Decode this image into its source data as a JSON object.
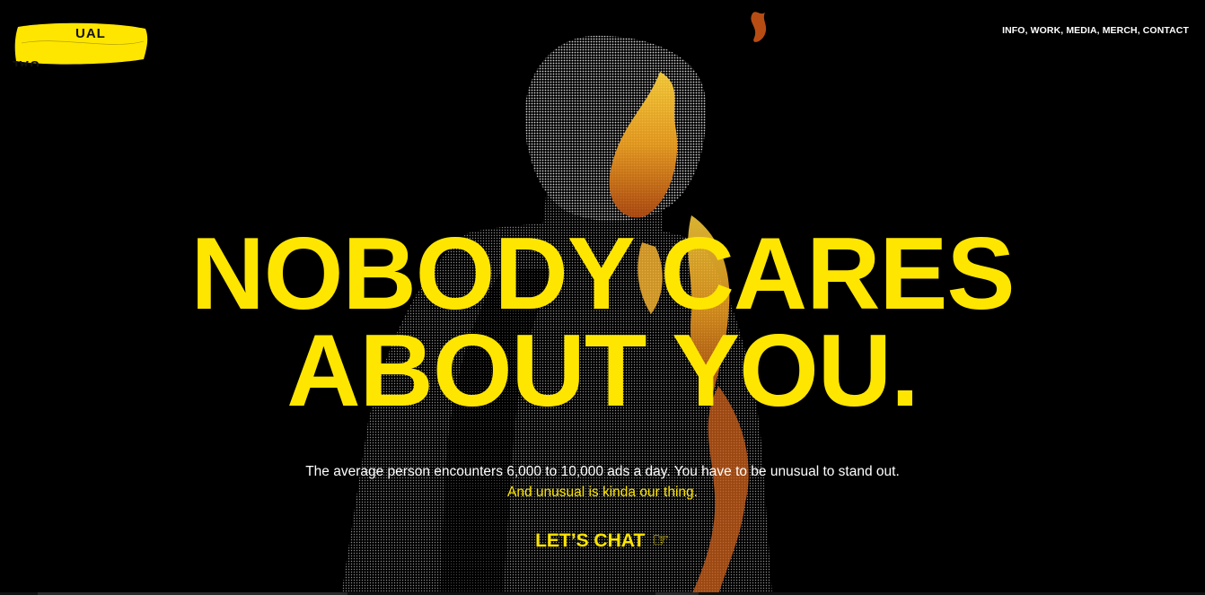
{
  "logo": {
    "text": "UNUSUAL",
    "color": "#ffe600"
  },
  "nav": {
    "items": [
      {
        "label": "INFO"
      },
      {
        "label": "WORK"
      },
      {
        "label": "MEDIA"
      },
      {
        "label": "MERCH"
      },
      {
        "label": "CONTACT"
      }
    ],
    "separator": ", "
  },
  "hero": {
    "line1": "NOBODY CARES",
    "line2": "ABOUT YOU.",
    "subtext_white": "The average person encounters 6,000 to 10,000 ads a day. You have to be unusual to stand out.",
    "subtext_yellow": "And unusual is kinda our thing.",
    "cta_label": "LET’S CHAT",
    "cta_icon": "pointing-hand-icon"
  },
  "colors": {
    "accent": "#ffe600",
    "background": "#000000",
    "text": "#ffffff",
    "fire": "#e8a020"
  }
}
